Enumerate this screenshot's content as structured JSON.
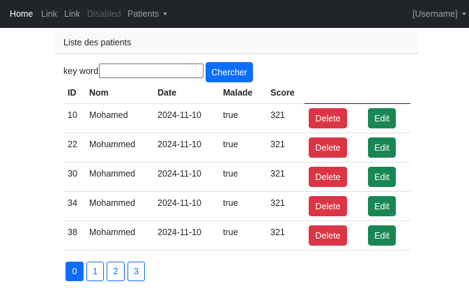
{
  "navbar": {
    "items": [
      "Home",
      "Link",
      "Link",
      "Disabled",
      "Patients"
    ],
    "user": "[Username]"
  },
  "card": {
    "title": "Liste des patients"
  },
  "search": {
    "label": "key word",
    "value": "",
    "button": "Chercher"
  },
  "table": {
    "headers": [
      "ID",
      "Nom",
      "Date",
      "Malade",
      "Score"
    ],
    "rows": [
      [
        "10",
        "Mohamed",
        "2024-11-10",
        "true",
        "321"
      ],
      [
        "22",
        "Mohammed",
        "2024-11-10",
        "true",
        "321"
      ],
      [
        "30",
        "Mohammed",
        "2024-11-10",
        "true",
        "321"
      ],
      [
        "34",
        "Mohammed",
        "2024-11-10",
        "true",
        "321"
      ],
      [
        "38",
        "Mohammed",
        "2024-11-10",
        "true",
        "321"
      ]
    ],
    "delete_label": "Delete",
    "edit_label": "Edit"
  },
  "pagination": {
    "pages": [
      "0",
      "1",
      "2",
      "3"
    ],
    "current": "0"
  },
  "colors": {
    "navbar": "#212529",
    "primary": "#0d6efd",
    "danger": "#dc3545",
    "success": "#198754"
  }
}
